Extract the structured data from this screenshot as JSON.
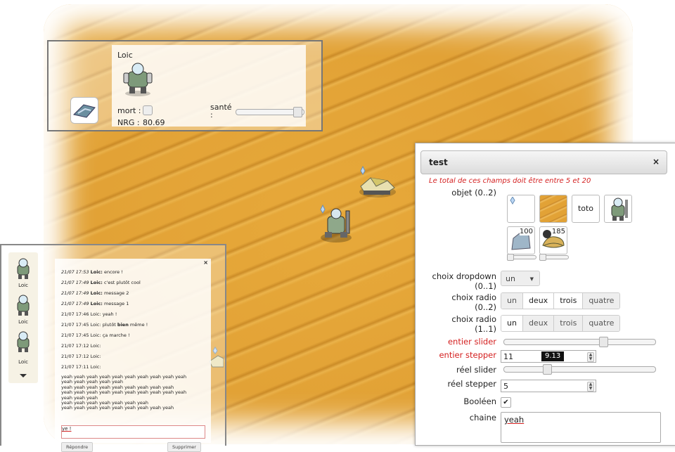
{
  "player": {
    "name": "Loic",
    "dead_label": "mort :",
    "nrg_label": "NRG :",
    "nrg_value": "80.69",
    "health_label_1": "santé",
    "health_label_2": ":",
    "health_level": 0.95
  },
  "chat": {
    "roster": [
      {
        "name": "Loic"
      },
      {
        "name": "Loic"
      },
      {
        "name": "Loic"
      }
    ],
    "messages": [
      {
        "time": "21/07 17:53",
        "author": "Loic:",
        "text": " encore !"
      },
      {
        "time": "21/07 17:49",
        "author": "Loic:",
        "text": " c'est plutôt cool"
      },
      {
        "time": "21/07 17:49",
        "author": "Loic:",
        "text": " message 2"
      },
      {
        "time": "21/07 17:49",
        "author": "Loic:",
        "text": " message 1"
      },
      {
        "line": "21/07 17:46 Loic: yeah !"
      },
      {
        "line_a": "21/07 17:45 Loic: plutôt ",
        "bold": "bien",
        "line_b": " même !"
      },
      {
        "line": "21/07 17:45 Loic: ça marche !"
      },
      {
        "line": "21/07 17:12 Loic:"
      },
      {
        "line": "21/07 17:12 Loic:"
      },
      {
        "line": "21/07 17:11 Loic:"
      }
    ],
    "spam": [
      "yeah yeah yeah yeah yeah yeah yeah yeah yeah yeah",
      "yeah yeah yeah yeah yeah",
      "yeah yeah yeah yeah yeah yeah yeah yeah yeah",
      "yeah yeah yeah yeah yeah yeah yeah yeah yeah yeah",
      "yeah yeah yeah",
      "yeah yeah yeah yeah yeah yeah yeah",
      "yeah yeah yeah yeah yeah yeah yeah yeah yeah"
    ],
    "input_value": "ye !",
    "reply_label": "Répondre",
    "delete_label": "Supprimer",
    "close_glyph": "×"
  },
  "dialog": {
    "title": "test",
    "close_glyph": "×",
    "note": "Le total de ces champs doit être entre 5 et 20",
    "objet_label": "objet (0..2)",
    "tile_text": "toto",
    "count_a": "100",
    "count_b": "185",
    "dropdown_label_1": "choix dropdown",
    "dropdown_label_2": "(0..1)",
    "dropdown_value": "un",
    "radio1_label_1": "choix radio",
    "radio1_label_2": "(0..2)",
    "radio2_label_1": "choix radio",
    "radio2_label_2": "(1..1)",
    "options": [
      "un",
      "deux",
      "trois",
      "quatre"
    ],
    "int_slider_label": "entier slider",
    "int_stepper_label": "entier stepper",
    "int_stepper_value": "11",
    "int_stepper_tooltip": "9.13",
    "real_slider_label": "réel slider",
    "real_stepper_label": "réel stepper",
    "real_stepper_value": "5",
    "bool_label": "Booléen",
    "string_label": "chaine",
    "string_value": "yeah",
    "int_slider_level": 0.66,
    "real_slider_level": 0.27
  },
  "colors": {
    "accent_red": "#d42020",
    "sand": "#e2a236"
  }
}
